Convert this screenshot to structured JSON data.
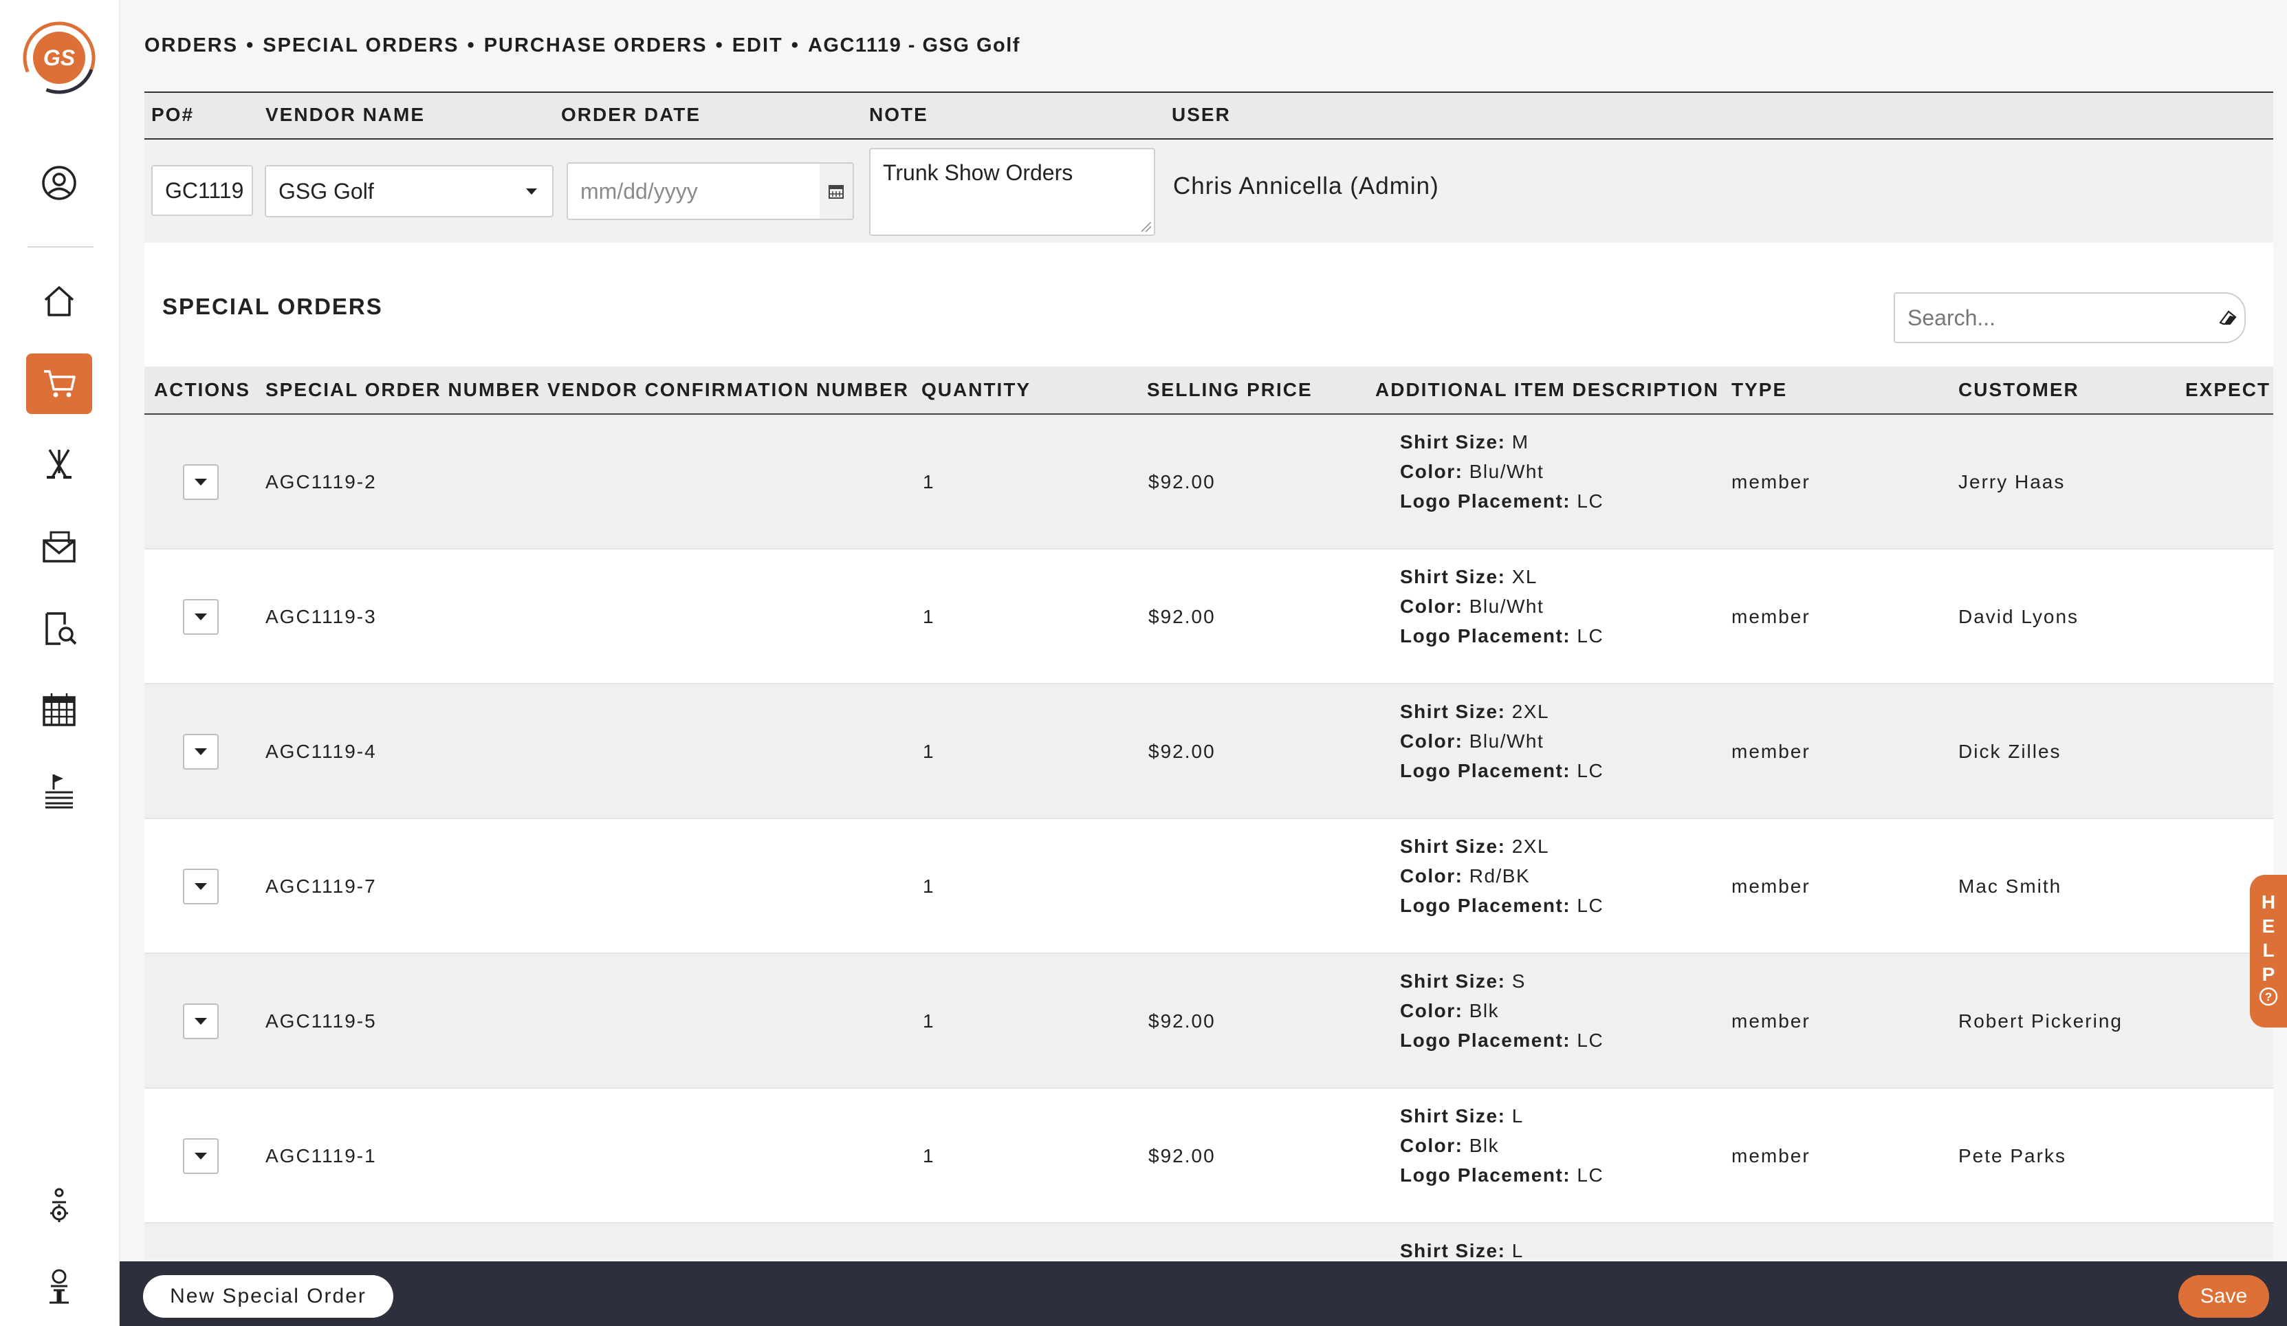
{
  "brand": {
    "logo_text": "GS",
    "accent": "#dc7036",
    "footer_bg": "#2e2f3d"
  },
  "breadcrumb": [
    "ORDERS",
    "SPECIAL ORDERS",
    "PURCHASE ORDERS",
    "EDIT",
    "AGC1119 - GSG Golf"
  ],
  "breadcrumb_sep": "•",
  "sidebar": {
    "items": [
      {
        "icon": "user-circle-icon"
      },
      {
        "icon": "home-icon"
      },
      {
        "icon": "cart-icon",
        "active": true
      },
      {
        "icon": "golf-clubs-icon"
      },
      {
        "icon": "mail-icon"
      },
      {
        "icon": "document-search-icon"
      },
      {
        "icon": "calendar-icon"
      },
      {
        "icon": "flag-tee-sheet-icon"
      },
      {
        "icon": "settings-user-icon"
      },
      {
        "icon": "golf-ball-tee-icon"
      }
    ]
  },
  "po": {
    "headers": {
      "po": "PO#",
      "vendor": "VENDOR NAME",
      "date": "ORDER DATE",
      "note": "NOTE",
      "user": "USER"
    },
    "po_number": "GC1119",
    "vendor": "GSG Golf",
    "date_placeholder": "mm/dd/yyyy",
    "note": "Trunk Show Orders",
    "user": "Chris Annicella (Admin)"
  },
  "special_orders": {
    "title": "SPECIAL ORDERS",
    "search_placeholder": "Search...",
    "columns": {
      "actions": "ACTIONS",
      "number": "SPECIAL ORDER NUMBER",
      "vendor_conf": "VENDOR CONFIRMATION NUMBER",
      "quantity": "QUANTITY",
      "price": "SELLING PRICE",
      "desc": "ADDITIONAL ITEM DESCRIPTION",
      "type": "TYPE",
      "customer": "CUSTOMER",
      "expected": "EXPECT"
    },
    "desc_labels": {
      "size": "Shirt Size:",
      "color": "Color:",
      "logo": "Logo Placement:"
    },
    "rows": [
      {
        "number": "AGC1119-2",
        "quantity": "1",
        "price": "$92.00",
        "size": "M",
        "color": "Blu/Wht",
        "logo": "LC",
        "type": "member",
        "customer": "Jerry Haas"
      },
      {
        "number": "AGC1119-3",
        "quantity": "1",
        "price": "$92.00",
        "size": "XL",
        "color": "Blu/Wht",
        "logo": "LC",
        "type": "member",
        "customer": "David Lyons"
      },
      {
        "number": "AGC1119-4",
        "quantity": "1",
        "price": "$92.00",
        "size": "2XL",
        "color": "Blu/Wht",
        "logo": "LC",
        "type": "member",
        "customer": "Dick Zilles"
      },
      {
        "number": "AGC1119-7",
        "quantity": "1",
        "price": "",
        "size": "2XL",
        "color": "Rd/BK",
        "logo": "LC",
        "type": "member",
        "customer": "Mac Smith"
      },
      {
        "number": "AGC1119-5",
        "quantity": "1",
        "price": "$92.00",
        "size": "S",
        "color": "Blk",
        "logo": "LC",
        "type": "member",
        "customer": "Robert Pickering"
      },
      {
        "number": "AGC1119-1",
        "quantity": "1",
        "price": "$92.00",
        "size": "L",
        "color": "Blk",
        "logo": "LC",
        "type": "member",
        "customer": "Pete Parks"
      },
      {
        "number": "",
        "quantity": "",
        "price": "",
        "size": "L",
        "color": "",
        "logo": "",
        "type": "",
        "customer": "",
        "partial": true
      }
    ]
  },
  "help": {
    "label": "HELP"
  },
  "footer": {
    "new_order_label": "New Special Order",
    "save_label": "Save"
  }
}
